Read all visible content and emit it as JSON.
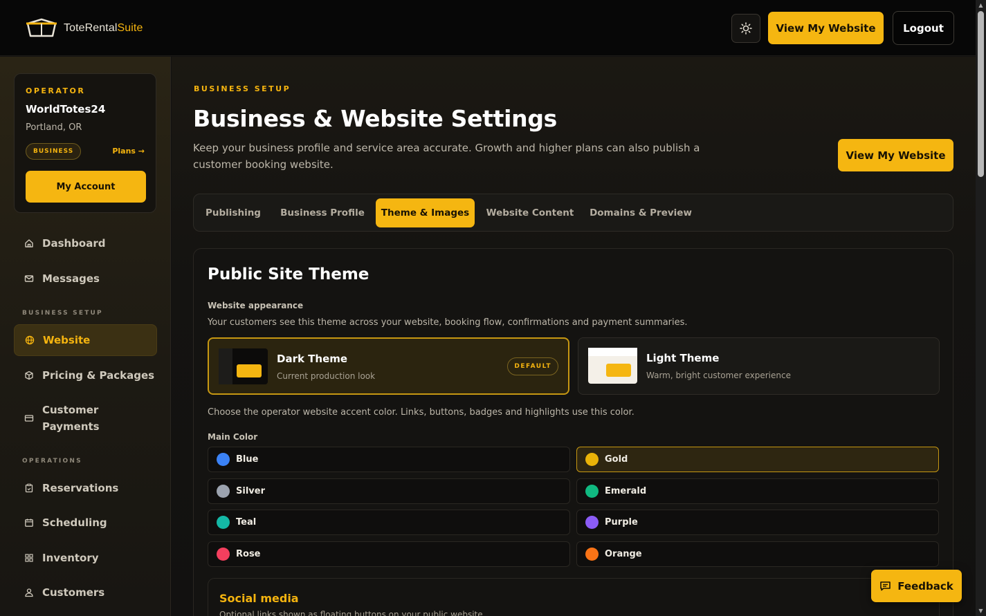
{
  "topbar": {
    "logo_text_main": "ToteRental",
    "logo_text_accent": "Suite",
    "view_website": "View My Website",
    "logout": "Logout"
  },
  "operator": {
    "label": "OPERATOR",
    "name": "WorldTotes24",
    "location": "Portland, OR",
    "plan_badge": "BUSINESS",
    "plans_link": "Plans →",
    "account_button": "My Account"
  },
  "sidebar": {
    "items": [
      {
        "label": "Dashboard",
        "icon": "home-icon"
      },
      {
        "label": "Messages",
        "icon": "mail-icon"
      }
    ],
    "section_business": "BUSINESS SETUP",
    "business_items": [
      {
        "label": "Website",
        "icon": "globe-icon",
        "active": true
      },
      {
        "label": "Pricing & Packages",
        "icon": "package-icon"
      },
      {
        "label": "Customer Payments",
        "icon": "card-icon"
      }
    ],
    "section_operations": "OPERATIONS",
    "operations_items": [
      {
        "label": "Reservations",
        "icon": "clipboard-icon"
      },
      {
        "label": "Scheduling",
        "icon": "calendar-icon"
      },
      {
        "label": "Inventory",
        "icon": "grid-icon"
      },
      {
        "label": "Customers",
        "icon": "users-icon"
      }
    ]
  },
  "main": {
    "eyebrow": "BUSINESS SETUP",
    "title": "Business & Website Settings",
    "description": "Keep your business profile and service area accurate. Growth and higher plans can also publish a customer booking website.",
    "view_website": "View My Website",
    "tabs": [
      {
        "label": "Publishing"
      },
      {
        "label": "Business Profile"
      },
      {
        "label": "Theme & Images",
        "active": true
      },
      {
        "label": "Website Content"
      },
      {
        "label": "Domains & Preview"
      }
    ]
  },
  "theme_panel": {
    "title": "Public Site Theme",
    "appearance_label": "Website appearance",
    "appearance_desc": "Your customers see this theme across your website, booking flow, confirmations and payment summaries.",
    "themes": [
      {
        "name": "Dark Theme",
        "desc": "Current production look",
        "badge": "DEFAULT",
        "selected": true
      },
      {
        "name": "Light Theme",
        "desc": "Warm, bright customer experience",
        "selected": false
      }
    ],
    "accent_desc": "Choose the operator website accent color. Links, buttons, badges and highlights use this color.",
    "main_color_label": "Main Color",
    "colors": [
      {
        "name": "Blue",
        "hex": "#3b82f6"
      },
      {
        "name": "Gold",
        "hex": "#eab308",
        "selected": true
      },
      {
        "name": "Silver",
        "hex": "#9ca3af"
      },
      {
        "name": "Emerald",
        "hex": "#10b981"
      },
      {
        "name": "Teal",
        "hex": "#14b8a6"
      },
      {
        "name": "Purple",
        "hex": "#8b5cf6"
      },
      {
        "name": "Rose",
        "hex": "#f43f5e"
      },
      {
        "name": "Orange",
        "hex": "#f97316"
      }
    ],
    "social_title": "Social media",
    "social_desc": "Optional links shown as floating buttons on your public website"
  },
  "feedback": "Feedback",
  "colors": {
    "accent": "#f5b611",
    "background": "#121110"
  }
}
